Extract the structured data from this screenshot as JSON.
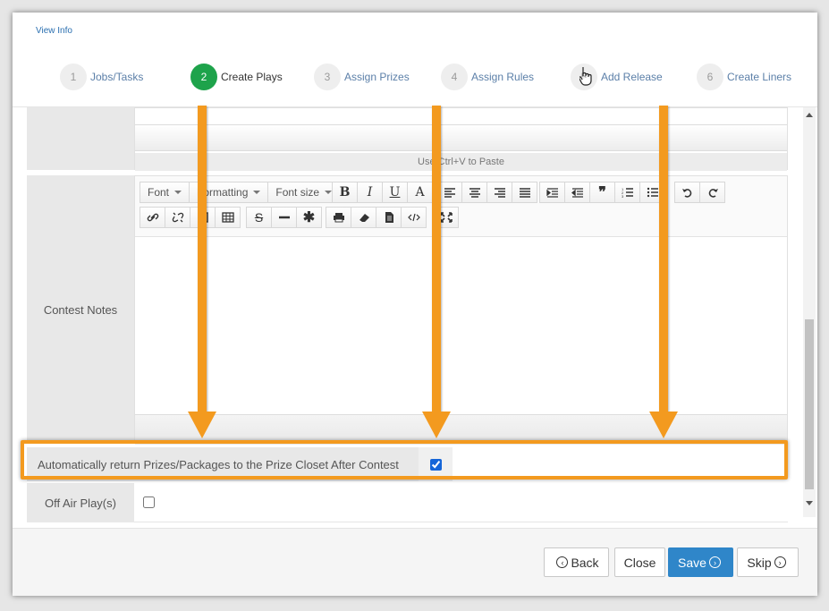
{
  "header": {
    "view_info": "View Info",
    "steps": [
      {
        "num": "1",
        "label": "Jobs/Tasks",
        "active": false
      },
      {
        "num": "2",
        "label": "Create Plays",
        "active": true
      },
      {
        "num": "3",
        "label": "Assign Prizes",
        "active": false
      },
      {
        "num": "4",
        "label": "Assign Rules",
        "active": false
      },
      {
        "num": "5",
        "label": "Add Release",
        "active": false
      },
      {
        "num": "6",
        "label": "Create Liners",
        "active": false
      }
    ]
  },
  "editor_top": {
    "paste_hint": "Use Ctrl+V to Paste"
  },
  "contest_notes": {
    "label": "Contest Notes",
    "toolbar": {
      "font": "Font",
      "formatting": "Formatting",
      "font_size": "Font size",
      "bold": "B",
      "italic": "I",
      "underline": "U",
      "color": "A"
    }
  },
  "auto_return": {
    "label": "Automatically return Prizes/Packages to the Prize Closet After Contest",
    "checked": true
  },
  "off_air": {
    "label": "Off Air Play(s)",
    "checked": false
  },
  "footer": {
    "back": "Back",
    "close": "Close",
    "save": "Save",
    "skip": "Skip"
  },
  "colors": {
    "accent": "#f39a1f",
    "active_step": "#1ea34b",
    "primary_button": "#2f86c9"
  }
}
